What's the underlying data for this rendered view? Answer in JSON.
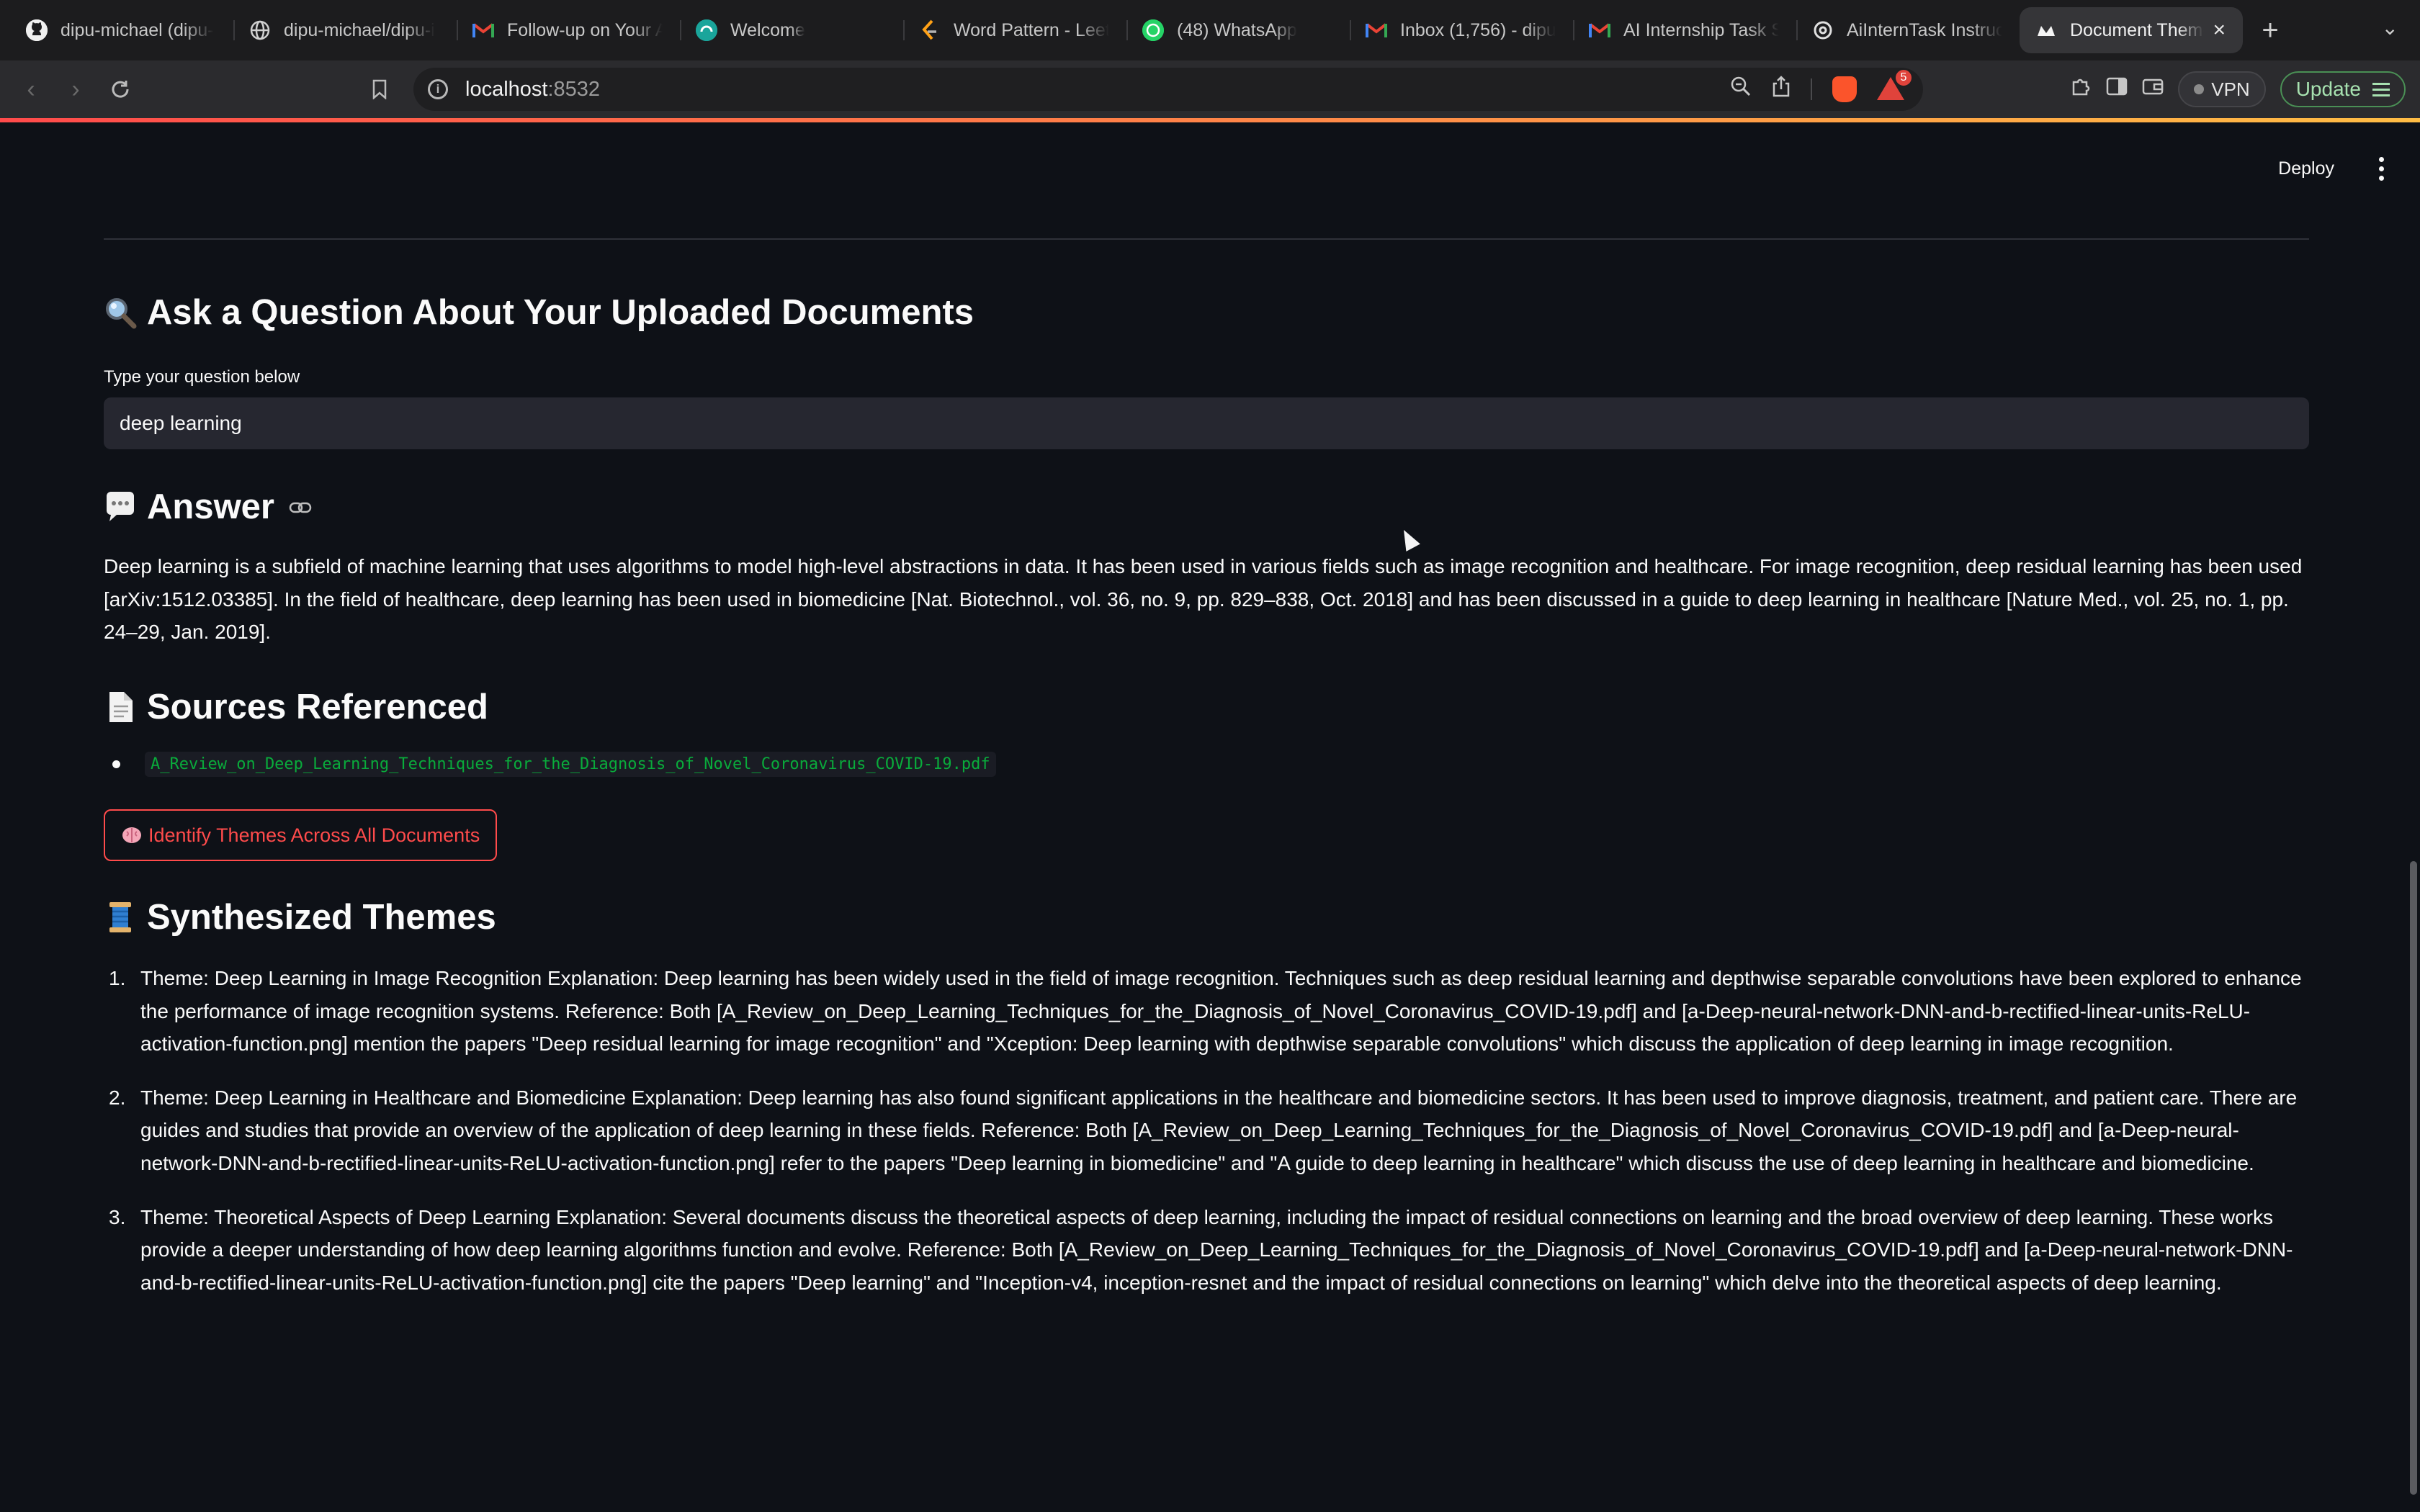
{
  "browser": {
    "tabs": [
      {
        "title": "dipu-michael (dipu-",
        "icon": "github-icon",
        "active": false
      },
      {
        "title": "dipu-michael/dipu-i",
        "icon": "globe-icon",
        "active": false
      },
      {
        "title": "Follow-up on Your A",
        "icon": "gmail-icon",
        "active": false
      },
      {
        "title": "Welcome",
        "icon": "welcome-icon",
        "active": false
      },
      {
        "title": "Word Pattern - Leet",
        "icon": "leetcode-icon",
        "active": false
      },
      {
        "title": "(48) WhatsApp",
        "icon": "whatsapp-icon",
        "active": false
      },
      {
        "title": "Inbox (1,756) - dipu",
        "icon": "gmail-icon",
        "active": false
      },
      {
        "title": "AI Internship Task S",
        "icon": "gmail-icon",
        "active": false
      },
      {
        "title": "AiInternTask Instruc",
        "icon": "openai-icon",
        "active": false
      },
      {
        "title": "Document Theme",
        "icon": "streamlit-icon",
        "active": true
      }
    ],
    "new_tab_label": "+",
    "address": {
      "host": "localhost",
      "port": ":8532"
    },
    "rewards_badge": "5",
    "vpn_label": "VPN",
    "update_label": "Update"
  },
  "app": {
    "deploy_label": "Deploy",
    "question_section": {
      "heading": "Ask a Question About Your Uploaded Documents",
      "input_label": "Type your question below",
      "input_value": "deep learning"
    },
    "answer_section": {
      "heading": "Answer",
      "text": "Deep learning is a subfield of machine learning that uses algorithms to model high-level abstractions in data. It has been used in various fields such as image recognition and healthcare. For image recognition, deep residual learning has been used [arXiv:1512.03385]. In the field of healthcare, deep learning has been used in biomedicine [Nat. Biotechnol., vol. 36, no. 9, pp. 829–838, Oct. 2018] and has been discussed in a guide to deep learning in healthcare [Nature Med., vol. 25, no. 1, pp. 24–29, Jan. 2019]."
    },
    "sources_section": {
      "heading": "Sources Referenced",
      "items": [
        "A_Review_on_Deep_Learning_Techniques_for_the_Diagnosis_of_Novel_Coronavirus_COVID-19.pdf"
      ]
    },
    "themes_button_label": "Identify Themes Across All Documents",
    "themes_section": {
      "heading": "Synthesized Themes",
      "items": [
        {
          "num": "1.",
          "text": "Theme: Deep Learning in Image Recognition Explanation: Deep learning has been widely used in the field of image recognition. Techniques such as deep residual learning and depthwise separable convolutions have been explored to enhance the performance of image recognition systems. Reference: Both [A_Review_on_Deep_Learning_Techniques_for_the_Diagnosis_of_Novel_Coronavirus_COVID-19.pdf] and [a-Deep-neural-network-DNN-and-b-rectified-linear-units-ReLU-activation-function.png] mention the papers \"Deep residual learning for image recognition\" and \"Xception: Deep learning with depthwise separable convolutions\" which discuss the application of deep learning in image recognition."
        },
        {
          "num": "2.",
          "text": "Theme: Deep Learning in Healthcare and Biomedicine Explanation: Deep learning has also found significant applications in the healthcare and biomedicine sectors. It has been used to improve diagnosis, treatment, and patient care. There are guides and studies that provide an overview of the application of deep learning in these fields. Reference: Both [A_Review_on_Deep_Learning_Techniques_for_the_Diagnosis_of_Novel_Coronavirus_COVID-19.pdf] and [a-Deep-neural-network-DNN-and-b-rectified-linear-units-ReLU-activation-function.png] refer to the papers \"Deep learning in biomedicine\" and \"A guide to deep learning in healthcare\" which discuss the use of deep learning in healthcare and biomedicine."
        },
        {
          "num": "3.",
          "text": "Theme: Theoretical Aspects of Deep Learning Explanation: Several documents discuss the theoretical aspects of deep learning, including the impact of residual connections on learning and the broad overview of deep learning. These works provide a deeper understanding of how deep learning algorithms function and evolve. Reference: Both [A_Review_on_Deep_Learning_Techniques_for_the_Diagnosis_of_Novel_Coronavirus_COVID-19.pdf] and [a-Deep-neural-network-DNN-and-b-rectified-linear-units-ReLU-activation-function.png] cite the papers \"Deep learning\" and \"Inception-v4, inception-resnet and the impact of residual connections on learning\" which delve into the theoretical aspects of deep learning."
        }
      ]
    }
  },
  "colors": {
    "background": "#0e1117",
    "accent": "#ff4b4b",
    "code_green": "#09ab3b",
    "input_bg": "#262730"
  }
}
